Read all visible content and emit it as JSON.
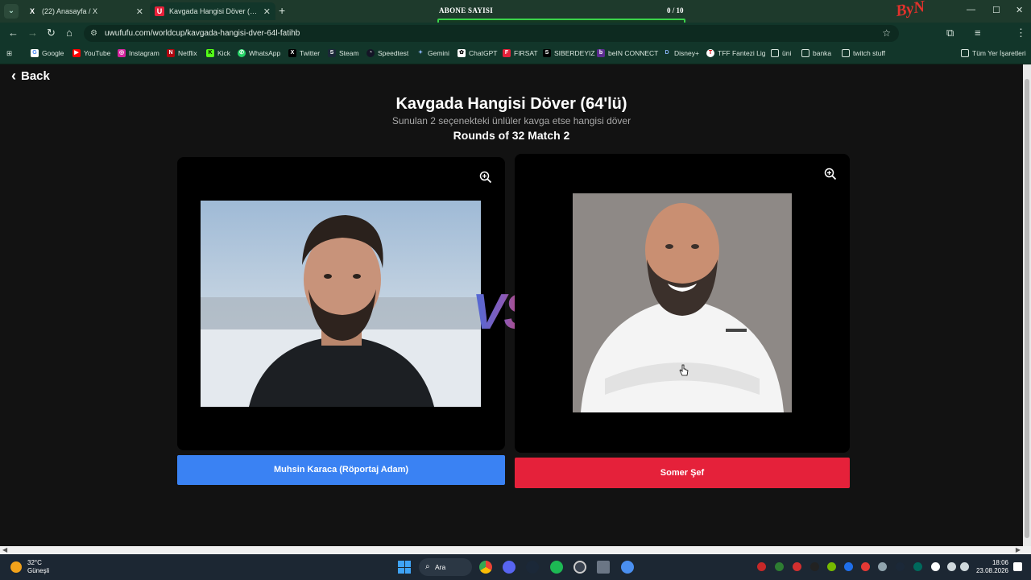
{
  "browser": {
    "tabs": [
      {
        "title": "(22) Anasayfa / X",
        "favicon": "X"
      },
      {
        "title": "Kavgada Hangisi Döver (64'lü)",
        "favicon": "U"
      }
    ],
    "url": "uwufufu.com/worldcup/kavgada-hangisi-dver-64l-fatihb",
    "bookmarks": [
      "Google",
      "YouTube",
      "Instagram",
      "Netflix",
      "Kick",
      "WhatsApp",
      "Twitter",
      "Steam",
      "Speedtest",
      "Gemini",
      "ChatGPT",
      "FIRSAT",
      "SIBERDEYIZ",
      "beIN CONNECT",
      "Disney+",
      "TFF Fantezi Lig",
      "üni",
      "banka",
      "twitch stuff"
    ],
    "all_bookmarks": "Tüm Yer İşaretleri"
  },
  "overlay": {
    "label": "ABONE SAYISI",
    "count": "0 / 10",
    "progress": 0
  },
  "page": {
    "back_label": "Back",
    "title": "Kavgada Hangisi Döver (64'lü)",
    "subtitle": "Sunulan 2 seçenekteki ünlüler kavga etse hangisi döver",
    "round": "Rounds of 32 Match 2",
    "vs": "VS",
    "left_choice": "Muhsin Karaca (Röportaj Adam)",
    "right_choice": "Somer Şef"
  },
  "taskbar": {
    "weather_temp": "32°C",
    "weather_desc": "Güneşli",
    "search": "Ara",
    "time": "18:06",
    "date": "23.08.2026"
  },
  "colors": {
    "left_button": "#3a82f3",
    "right_button": "#e5213a",
    "progress_border": "#3ad24a"
  }
}
